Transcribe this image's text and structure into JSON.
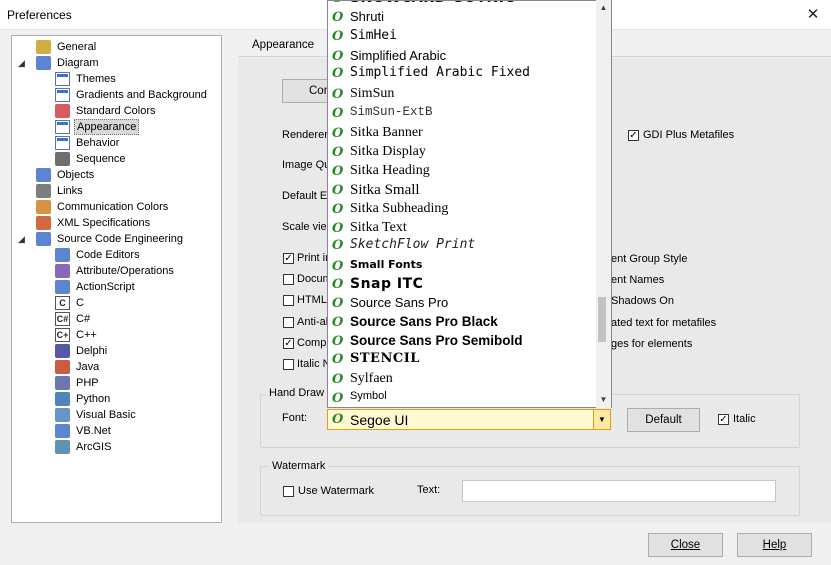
{
  "window": {
    "title": "Preferences",
    "close_glyph": "✕"
  },
  "tree": [
    {
      "label": "General",
      "icon": "general-icon",
      "indent": 0,
      "expander": ""
    },
    {
      "label": "Diagram",
      "icon": "diagram-icon",
      "indent": 0,
      "expander": "◢"
    },
    {
      "label": "Themes",
      "icon": "page-icon",
      "indent": 1
    },
    {
      "label": "Gradients and Background",
      "icon": "page-icon",
      "indent": 1
    },
    {
      "label": "Standard Colors",
      "icon": "colors-icon",
      "indent": 1
    },
    {
      "label": "Appearance",
      "icon": "page-icon",
      "indent": 1,
      "selected": true
    },
    {
      "label": "Behavior",
      "icon": "page-icon",
      "indent": 1
    },
    {
      "label": "Sequence",
      "icon": "sequence-icon",
      "indent": 1
    },
    {
      "label": "Objects",
      "icon": "objects-icon",
      "indent": 0
    },
    {
      "label": "Links",
      "icon": "links-icon",
      "indent": 0
    },
    {
      "label": "Communication Colors",
      "icon": "communication-icon",
      "indent": 0
    },
    {
      "label": "XML Specifications",
      "icon": "xml-icon",
      "indent": 0
    },
    {
      "label": "Source Code Engineering",
      "icon": "source-code-icon",
      "indent": 0,
      "expander": "◢"
    },
    {
      "label": "Code Editors",
      "icon": "code-editor-icon",
      "indent": 1
    },
    {
      "label": "Attribute/Operations",
      "icon": "attribute-icon",
      "indent": 1
    },
    {
      "label": "ActionScript",
      "icon": "actionscript-icon",
      "indent": 1
    },
    {
      "label": "C",
      "icon": "c-icon",
      "indent": 1,
      "glyph": "C"
    },
    {
      "label": "C#",
      "icon": "csharp-icon",
      "indent": 1,
      "glyph": "C#"
    },
    {
      "label": "C++",
      "icon": "cpp-icon",
      "indent": 1,
      "glyph": "C+"
    },
    {
      "label": "Delphi",
      "icon": "delphi-icon",
      "indent": 1
    },
    {
      "label": "Java",
      "icon": "java-icon",
      "indent": 1
    },
    {
      "label": "PHP",
      "icon": "php-icon",
      "indent": 1
    },
    {
      "label": "Python",
      "icon": "python-icon",
      "indent": 1
    },
    {
      "label": "Visual Basic",
      "icon": "visual-basic-icon",
      "indent": 1
    },
    {
      "label": "VB.Net",
      "icon": "vbnet-icon",
      "indent": 1
    },
    {
      "label": "ArcGIS",
      "icon": "arcgis-icon",
      "indent": 1
    }
  ],
  "panel": {
    "heading": "Appearance",
    "configure_button": "Con",
    "renderer_label": "Renderer",
    "image_quality_label": "Image Qu",
    "default_label": "Default E",
    "scale_label": "Scale vie",
    "gdi_plus_label": "GDI Plus Metafiles",
    "options_left": [
      {
        "label": "Print in",
        "checked": true
      },
      {
        "label": "Docum",
        "checked": false
      },
      {
        "label": "HTML",
        "checked": false
      },
      {
        "label": "Anti-ali",
        "checked": false
      },
      {
        "label": "Compr",
        "checked": true
      },
      {
        "label": "Italic N",
        "checked": false
      }
    ],
    "options_right": [
      "ent Group Style",
      "ent Names",
      "Shadows On",
      "ated text for metafiles",
      "ges for elements"
    ],
    "hand_drawn_group": "Hand Draw",
    "font_label": "Font:",
    "font_value": "Segoe UI",
    "default_button": "Default",
    "italic_label": "Italic",
    "italic_checked": true,
    "watermark_group": "Watermark",
    "use_watermark_label": "Use Watermark",
    "use_watermark_checked": false,
    "text_label": "Text:",
    "text_value": ""
  },
  "font_list": [
    {
      "name": "SNOWCARD GOTHIC",
      "style": "heavy"
    },
    {
      "name": "Shruti",
      "style": "normal"
    },
    {
      "name": "SimHei",
      "style": "mono"
    },
    {
      "name": "Simplified Arabic",
      "style": "normal"
    },
    {
      "name": "Simplified Arabic Fixed",
      "style": "mono"
    },
    {
      "name": "SimSun",
      "style": "serif"
    },
    {
      "name": "SimSun-ExtB",
      "style": "mono-light"
    },
    {
      "name": "Sitka Banner",
      "style": "serif"
    },
    {
      "name": "Sitka Display",
      "style": "serif"
    },
    {
      "name": "Sitka Heading",
      "style": "serif"
    },
    {
      "name": "Sitka Small",
      "style": "serif-large"
    },
    {
      "name": "Sitka Subheading",
      "style": "serif"
    },
    {
      "name": "Sitka Text",
      "style": "serif"
    },
    {
      "name": "SketchFlow Print",
      "style": "sketch"
    },
    {
      "name": "Small Fonts",
      "style": "tiny-bold"
    },
    {
      "name": "Snap ITC",
      "style": "heavy"
    },
    {
      "name": "Source Sans Pro",
      "style": "normal"
    },
    {
      "name": "Source Sans Pro Black",
      "style": "bold"
    },
    {
      "name": "Source Sans Pro Semibold",
      "style": "semibold"
    },
    {
      "name": "STENCIL",
      "style": "stencil"
    },
    {
      "name": "Sylfaen",
      "style": "serif"
    },
    {
      "name": "Symbol",
      "style": "small"
    }
  ],
  "footer": {
    "close_button": "Close",
    "help_button": "Help"
  }
}
